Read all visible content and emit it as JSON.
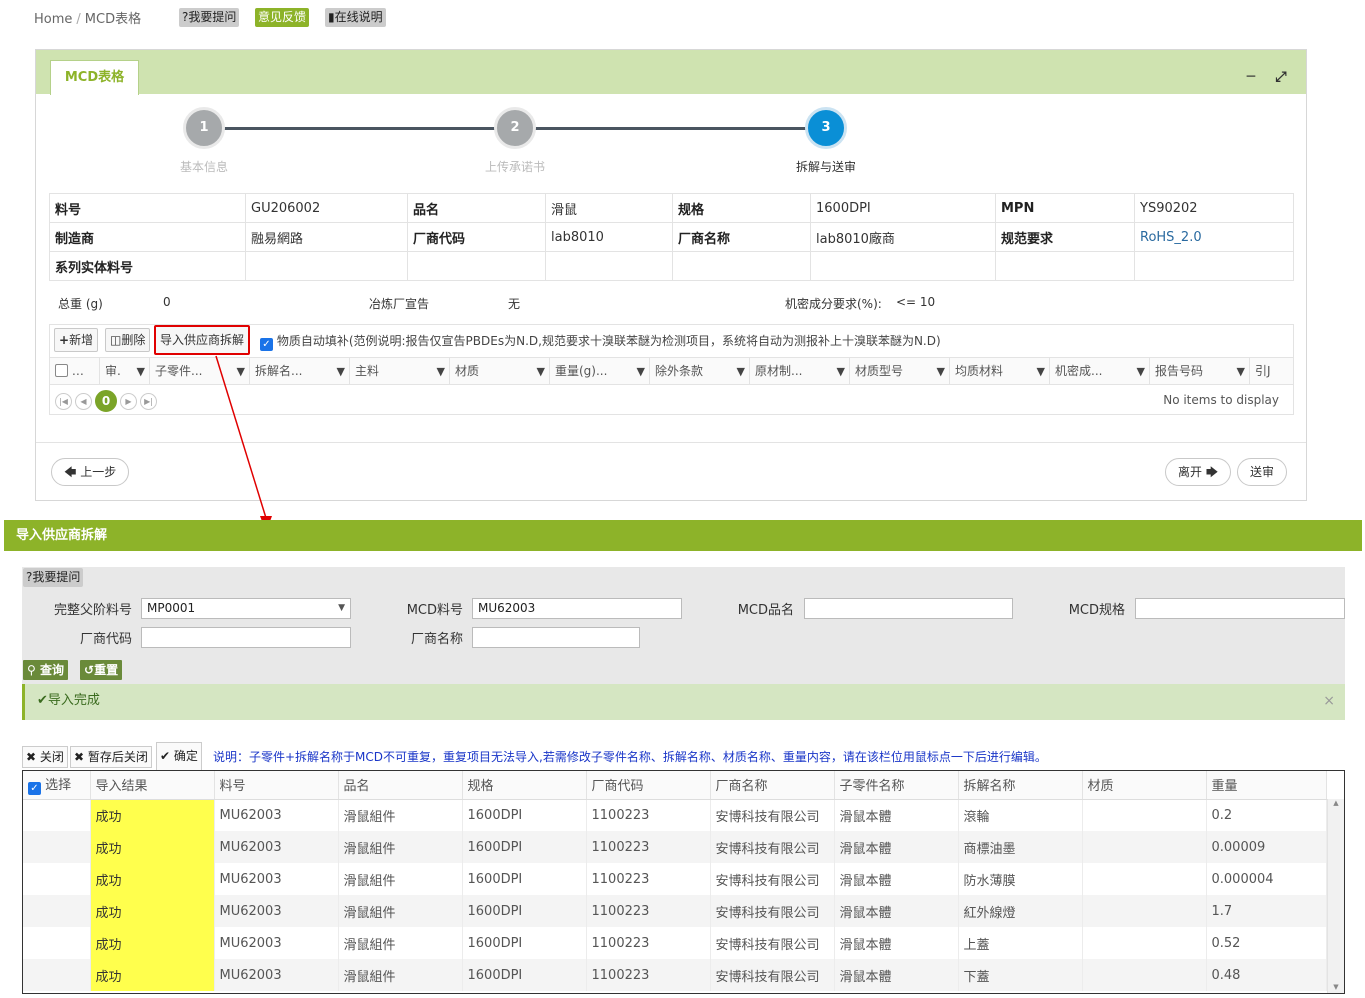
{
  "breadcrumb": {
    "home": "Home",
    "sep": "/",
    "current": "MCD表格"
  },
  "top_buttons": {
    "ask": "?我要提问",
    "feedback": "意见反馈",
    "manual": "在线说明"
  },
  "panel": {
    "tab": "MCD表格",
    "minimize_icon": "minus-icon",
    "expand_icon": "expand-icon"
  },
  "steps": [
    {
      "num": "1",
      "label": "基本信息"
    },
    {
      "num": "2",
      "label": "上传承诺书"
    },
    {
      "num": "3",
      "label": "拆解与送审"
    }
  ],
  "info": {
    "row1": [
      "料号",
      "GU206002",
      "品名",
      "滑鼠",
      "规格",
      "1600DPI",
      "MPN",
      "YS90202"
    ],
    "row2": [
      "制造商",
      "融易網路",
      "厂商代码",
      "lab8010",
      "厂商名称",
      "lab8010廠商",
      "规范要求",
      "RoHS_2.0"
    ],
    "row3": [
      "系列实体料号"
    ]
  },
  "weights": {
    "total_label": "总重 (g)",
    "total_value": "0",
    "smelter_label": "冶炼厂宣告",
    "smelter_value": "无",
    "secret_label": "机密成分要求(%):",
    "secret_value": "<= 10"
  },
  "grid_toolbar": {
    "add": "新增",
    "delete": "删除",
    "import": "导入供应商拆解",
    "autofill": "物质自动填补(范例说明:报告仅宣告PBDEs为N.D,规范要求十溴联苯醚为检测项目，系统将自动为测报补上十溴联苯醚为N.D)"
  },
  "grid_columns": [
    "",
    "审.",
    "子零件...",
    "拆解名...",
    "主料",
    "材质",
    "重量(g)...",
    "除外条款",
    "原材制...",
    "材质型号",
    "均质材料",
    "机密成...",
    "报告号码",
    "引J"
  ],
  "pager": {
    "current": "0",
    "empty": "No items to display"
  },
  "nav": {
    "prev": "上一步",
    "leave": "离开",
    "submit": "送审"
  },
  "dialog": {
    "title": "导入供应商拆解",
    "ask": "?我要提问",
    "fields": {
      "parent_label": "完整父阶料号",
      "parent_value": "MP0001",
      "mcd_no_label": "MCD料号",
      "mcd_no_value": "MU62003",
      "mcd_name_label": "MCD品名",
      "mcd_name_value": "",
      "mcd_spec_label": "MCD规格",
      "mcd_spec_value": "",
      "vendor_code_label": "厂商代码",
      "vendor_code_value": "",
      "vendor_name_label": "厂商名称",
      "vendor_name_value": ""
    },
    "search": "查询",
    "reset": "重置",
    "success": "导入完成",
    "close": "关闭",
    "save_close": "暂存后关闭",
    "confirm": "确定",
    "note": "说明：子零件+拆解名称于MCD不可重复，重复项目无法导入,若需修改子零件名称、拆解名称、材质名称、重量内容，请在该栏位用鼠标点一下后进行编辑。",
    "columns": [
      "选择",
      "导入结果",
      "料号",
      "品名",
      "规格",
      "厂商代码",
      "厂商名称",
      "子零件名称",
      "拆解名称",
      "材质",
      "重量"
    ],
    "rows": [
      [
        "成功",
        "MU62003",
        "滑鼠組件",
        "1600DPI",
        "1100223",
        "安博科技有限公司",
        "滑鼠本體",
        "滾輪",
        "",
        "0.2"
      ],
      [
        "成功",
        "MU62003",
        "滑鼠組件",
        "1600DPI",
        "1100223",
        "安博科技有限公司",
        "滑鼠本體",
        "商標油墨",
        "",
        "0.00009"
      ],
      [
        "成功",
        "MU62003",
        "滑鼠組件",
        "1600DPI",
        "1100223",
        "安博科技有限公司",
        "滑鼠本體",
        "防水薄膜",
        "",
        "0.000004"
      ],
      [
        "成功",
        "MU62003",
        "滑鼠組件",
        "1600DPI",
        "1100223",
        "安博科技有限公司",
        "滑鼠本體",
        "紅外線燈",
        "",
        "1.7"
      ],
      [
        "成功",
        "MU62003",
        "滑鼠組件",
        "1600DPI",
        "1100223",
        "安博科技有限公司",
        "滑鼠本體",
        "上蓋",
        "",
        "0.52"
      ],
      [
        "成功",
        "MU62003",
        "滑鼠組件",
        "1600DPI",
        "1100223",
        "安博科技有限公司",
        "滑鼠本體",
        "下蓋",
        "",
        "0.48"
      ]
    ]
  },
  "colors": {
    "accent": "#8db329",
    "step_active": "#0a8fd6",
    "highlight": "#ffff4d",
    "annotation": "#e00000"
  }
}
